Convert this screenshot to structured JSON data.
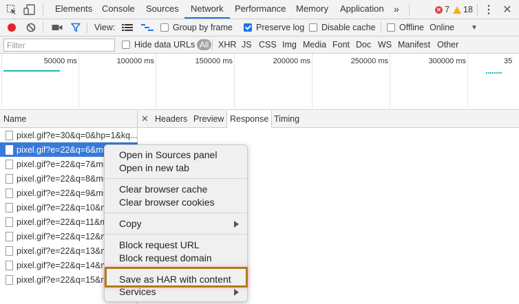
{
  "top_tabs": [
    "Elements",
    "Console",
    "Sources",
    "Network",
    "Performance",
    "Memory",
    "Application"
  ],
  "top_more": "»",
  "error_count": "7",
  "warning_count": "18",
  "toolbar": {
    "view_label": "View:",
    "group_by_frame": "Group by frame",
    "preserve_log": "Preserve log",
    "disable_cache": "Disable cache",
    "offline": "Offline",
    "throttle": "Online"
  },
  "filter": {
    "placeholder": "Filter",
    "hide_data_urls": "Hide data URLs",
    "types": [
      "All",
      "XHR",
      "JS",
      "CSS",
      "Img",
      "Media",
      "Font",
      "Doc",
      "WS",
      "Manifest",
      "Other"
    ]
  },
  "overview_ticks": [
    "50000 ms",
    "100000 ms",
    "150000 ms",
    "200000 ms",
    "250000 ms",
    "300000 ms",
    "35"
  ],
  "list_header": "Name",
  "requests": [
    "pixel.gif?e=30&q=0&hp=1&kq...",
    "pixel.gif?e=22&q=6&m=",
    "pixel.gif?e=22&q=7&m=",
    "pixel.gif?e=22&q=8&m=",
    "pixel.gif?e=22&q=9&m=",
    "pixel.gif?e=22&q=10&m",
    "pixel.gif?e=22&q=11&m",
    "pixel.gif?e=22&q=12&m",
    "pixel.gif?e=22&q=13&m",
    "pixel.gif?e=22&q=14&m",
    "pixel.gif?e=22&q=15&m"
  ],
  "detail_tabs": [
    "Headers",
    "Preview",
    "Response",
    "Timing"
  ],
  "context_menu": {
    "open_sources": "Open in Sources panel",
    "open_new_tab": "Open in new tab",
    "clear_cache": "Clear browser cache",
    "clear_cookies": "Clear browser cookies",
    "copy": "Copy",
    "block_url": "Block request URL",
    "block_domain": "Block request domain",
    "save_har": "Save as HAR with content",
    "services": "Services"
  },
  "colors": {
    "accent": "#1a73e8",
    "selection": "#3879d9",
    "record": "#e4252a",
    "highlight_border": "#b07c12",
    "timeline_bar": "#21b0ba"
  }
}
